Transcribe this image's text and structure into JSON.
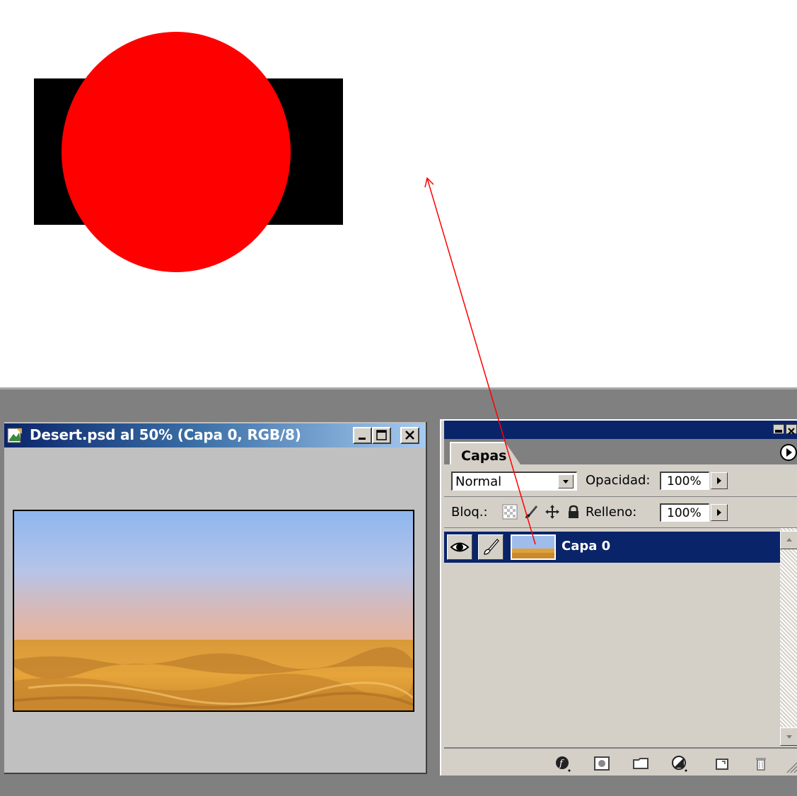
{
  "document_window": {
    "title": "Desert.psd al 50% (Capa 0, RGB/8)",
    "minimize_icon": "minimize-icon",
    "maximize_icon": "maximize-icon",
    "close_icon": "close-icon"
  },
  "layers_panel": {
    "tab_label": "Capas",
    "blend_mode": "Normal",
    "opacity_label": "Opacidad:",
    "opacity_value": "100%",
    "lock_label": "Bloq.:",
    "fill_label": "Relleno:",
    "fill_value": "100%",
    "layers": [
      {
        "name": "Capa 0",
        "selected": true,
        "visible": true
      }
    ],
    "footer_icons": [
      "layer-style-icon",
      "layer-mask-icon",
      "new-group-icon",
      "adjustment-layer-icon",
      "new-layer-icon",
      "trash-icon"
    ]
  },
  "colors": {
    "title_gradient_start": "#0a246a",
    "title_gradient_end": "#a6caf0",
    "selection": "#0a246a",
    "annotation_arrow": "#ff0000",
    "circle": "#ff0000",
    "rect": "#000000"
  }
}
